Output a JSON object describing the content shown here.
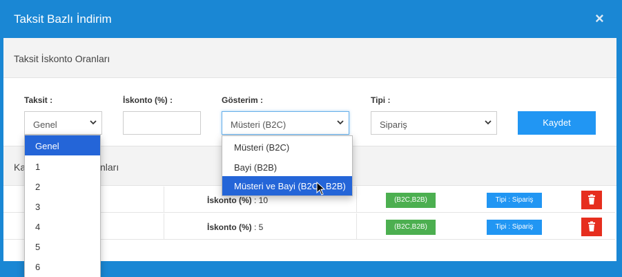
{
  "modal": {
    "title": "Taksit Bazlı İndirim",
    "close": "×"
  },
  "section1": {
    "title": "Taksit İskonto Oranları"
  },
  "form": {
    "taksit_label": "Taksit :",
    "iskonto_label": "İskonto (%) :",
    "gosterim_label": "Gösterim :",
    "tipi_label": "Tipi :",
    "taksit_value": "Genel",
    "iskonto_value": "",
    "gosterim_value": "Müsteri (B2C)",
    "tipi_value": "Sipariş",
    "save_label": "Kaydet"
  },
  "section2": {
    "title_left": "Ka",
    "title_right": "nları"
  },
  "rows": [
    {
      "iskonto_label": "İskonto (%)",
      "iskonto_value": ": 10",
      "gosterim_badge": "(B2C,B2B)",
      "tipi_badge": "Tipi : Sipariş"
    },
    {
      "iskonto_label": "İskonto (%)",
      "iskonto_value": ": 5",
      "gosterim_badge": "(B2C,B2B)",
      "tipi_badge": "Tipi : Sipariş"
    }
  ],
  "taksit_dropdown": [
    "Genel",
    "1",
    "2",
    "3",
    "4",
    "5",
    "6"
  ],
  "gosterim_dropdown": [
    "Müsteri (B2C)",
    "Bayi (B2B)",
    "Müsteri ve Bayi (B2C , B2B)"
  ],
  "colors": {
    "header": "#1a87d4",
    "save": "#2196f3",
    "badge_green": "#4caf50",
    "badge_blue": "#2196f3",
    "delete": "#e62e1e",
    "dropdown_active": "#2465d8"
  },
  "icons": {
    "close": "close-icon",
    "chevron": "chevron-down-icon",
    "delete": "trash-icon",
    "cursor": "mouse-pointer-icon"
  }
}
